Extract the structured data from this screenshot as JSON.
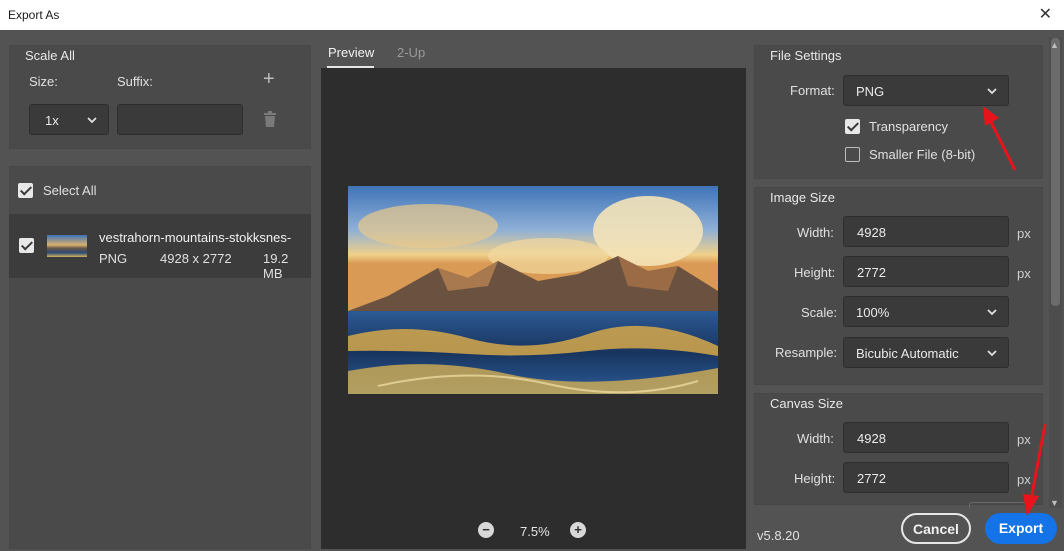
{
  "window": {
    "title": "Export As",
    "close_glyph": "✕"
  },
  "scale_all": {
    "title": "Scale All",
    "size_label": "Size:",
    "suffix_label": "Suffix:",
    "size_value": "1x",
    "suffix_value": "",
    "add_glyph": "+",
    "select_all_label": "Select All",
    "select_all_checked": true
  },
  "files": [
    {
      "name": "vestrahorn-mountains-stokksnes-",
      "format": "PNG",
      "dimensions": "4928 x 2772",
      "size": "19.2 MB",
      "checked": true
    }
  ],
  "preview": {
    "tabs": [
      {
        "label": "Preview",
        "active": true
      },
      {
        "label": "2-Up",
        "active": false
      }
    ],
    "zoom": "7.5%"
  },
  "file_settings": {
    "title": "File Settings",
    "format_label": "Format:",
    "format_value": "PNG",
    "transparency_label": "Transparency",
    "transparency_checked": true,
    "smaller_file_label": "Smaller File (8-bit)",
    "smaller_file_checked": false
  },
  "image_size": {
    "title": "Image Size",
    "width_label": "Width:",
    "width_value": "4928",
    "height_label": "Height:",
    "height_value": "2772",
    "scale_label": "Scale:",
    "scale_value": "100%",
    "resample_label": "Resample:",
    "resample_value": "Bicubic Automatic",
    "unit": "px"
  },
  "canvas_size": {
    "title": "Canvas Size",
    "width_label": "Width:",
    "width_value": "4928",
    "height_label": "Height:",
    "height_value": "2772",
    "unit": "px"
  },
  "footer": {
    "version": "v5.8.20",
    "cancel_label": "Cancel",
    "export_label": "Export"
  },
  "colors": {
    "accent": "#1473e6",
    "annotation_arrow": "#e8141c",
    "background": "#535353"
  }
}
